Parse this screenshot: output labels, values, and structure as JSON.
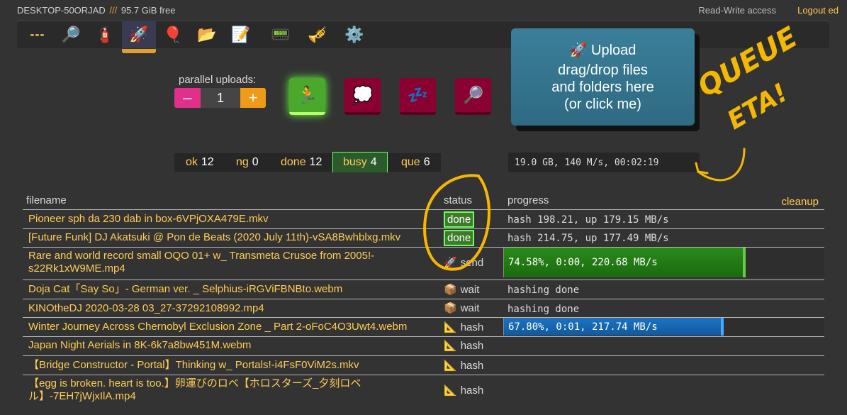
{
  "header": {
    "hostname": "DESKTOP-50ORJAD",
    "separator": "///",
    "free_space": "95.7 GiB free",
    "access": "Read-Write access",
    "logout": "Logout ed"
  },
  "toolbar": {
    "dash_label": "---",
    "icons": [
      "search-icon",
      "extinguisher-icon",
      "rocket-icon",
      "balloon-icon",
      "folder-icon",
      "notepad-icon",
      "pager-icon",
      "trumpet-icon",
      "gear-icon"
    ],
    "active": "rocket-icon"
  },
  "parallel": {
    "label": "parallel uploads:",
    "minus": "–",
    "value": "1",
    "plus": "+"
  },
  "upload_box": {
    "title": "Upload",
    "line1": "drag/drop files",
    "line2": "and folders here",
    "line3": "(or click me)"
  },
  "stats": {
    "ok": {
      "k": "ok",
      "v": "12"
    },
    "ng": {
      "k": "ng",
      "v": "0"
    },
    "done": {
      "k": "done",
      "v": "12"
    },
    "busy": {
      "k": "busy",
      "v": "4"
    },
    "que": {
      "k": "que",
      "v": "6"
    }
  },
  "eta": "19.0 GB, 140 M/s, 00:02:19",
  "table": {
    "col_filename": "filename",
    "col_status": "status",
    "col_progress": "progress",
    "cleanup": "cleanup",
    "rows": [
      {
        "name": "Pioneer sph da 230 dab in box-6VPjOXA479E.mkv",
        "status": "done",
        "progress": "hash 198.21, up 179.15 MB/s"
      },
      {
        "name": "[Future Funk] DJ Akatsuki @ Pon de Beats (2020 July 11th)-vSA8Bwhblxg.mkv",
        "status": "done",
        "progress": "hash 214.75, up 177.49 MB/s"
      },
      {
        "name": "Rare and world record small OQO 01+ w_ Transmeta Crusoe from 2005!-s22Rk1xW9ME.mp4",
        "status": "send",
        "progress": "74.58%, 0:00, 220.68 MB/s",
        "pct": 74.58
      },
      {
        "name": "Doja Cat「Say So」- German ver. _ Selphius-iRGViFBNBto.webm",
        "status": "wait",
        "progress": "hashing done"
      },
      {
        "name": "KINOtheDJ 2020-03-28 03_27-37292108992.mp4",
        "status": "wait",
        "progress": "hashing done"
      },
      {
        "name": "Winter Journey Across Chernobyl Exclusion Zone _ Part 2-oFoC4O3Uwt4.webm",
        "status": "hash",
        "progress": "67.80%, 0:01, 217.74 MB/s",
        "pct": 67.8
      },
      {
        "name": "Japan Night Aerials in 8K-6k7a8bw451M.webm",
        "status": "hash",
        "progress": ""
      },
      {
        "name": "【Bridge Constructor - Portal】Thinking w_ Portals!-i4FsF0ViM2s.mkv",
        "status": "hash",
        "progress": ""
      },
      {
        "name": "【egg is broken. heart is too.】卵運びのロベ【ホロスターズ_夕刻ロベル】-7EH7jWjxIlA.mp4",
        "status": "hash",
        "progress": ""
      }
    ]
  },
  "annotations": {
    "queue": "QUEUE",
    "eta": "ETA!"
  },
  "colors": {
    "accent": "#ffcc55",
    "done_border": "#6dff5e",
    "send_bar": "#2b8a1a",
    "hash_bar": "#1d72c0",
    "annotation": "#f5b800"
  }
}
